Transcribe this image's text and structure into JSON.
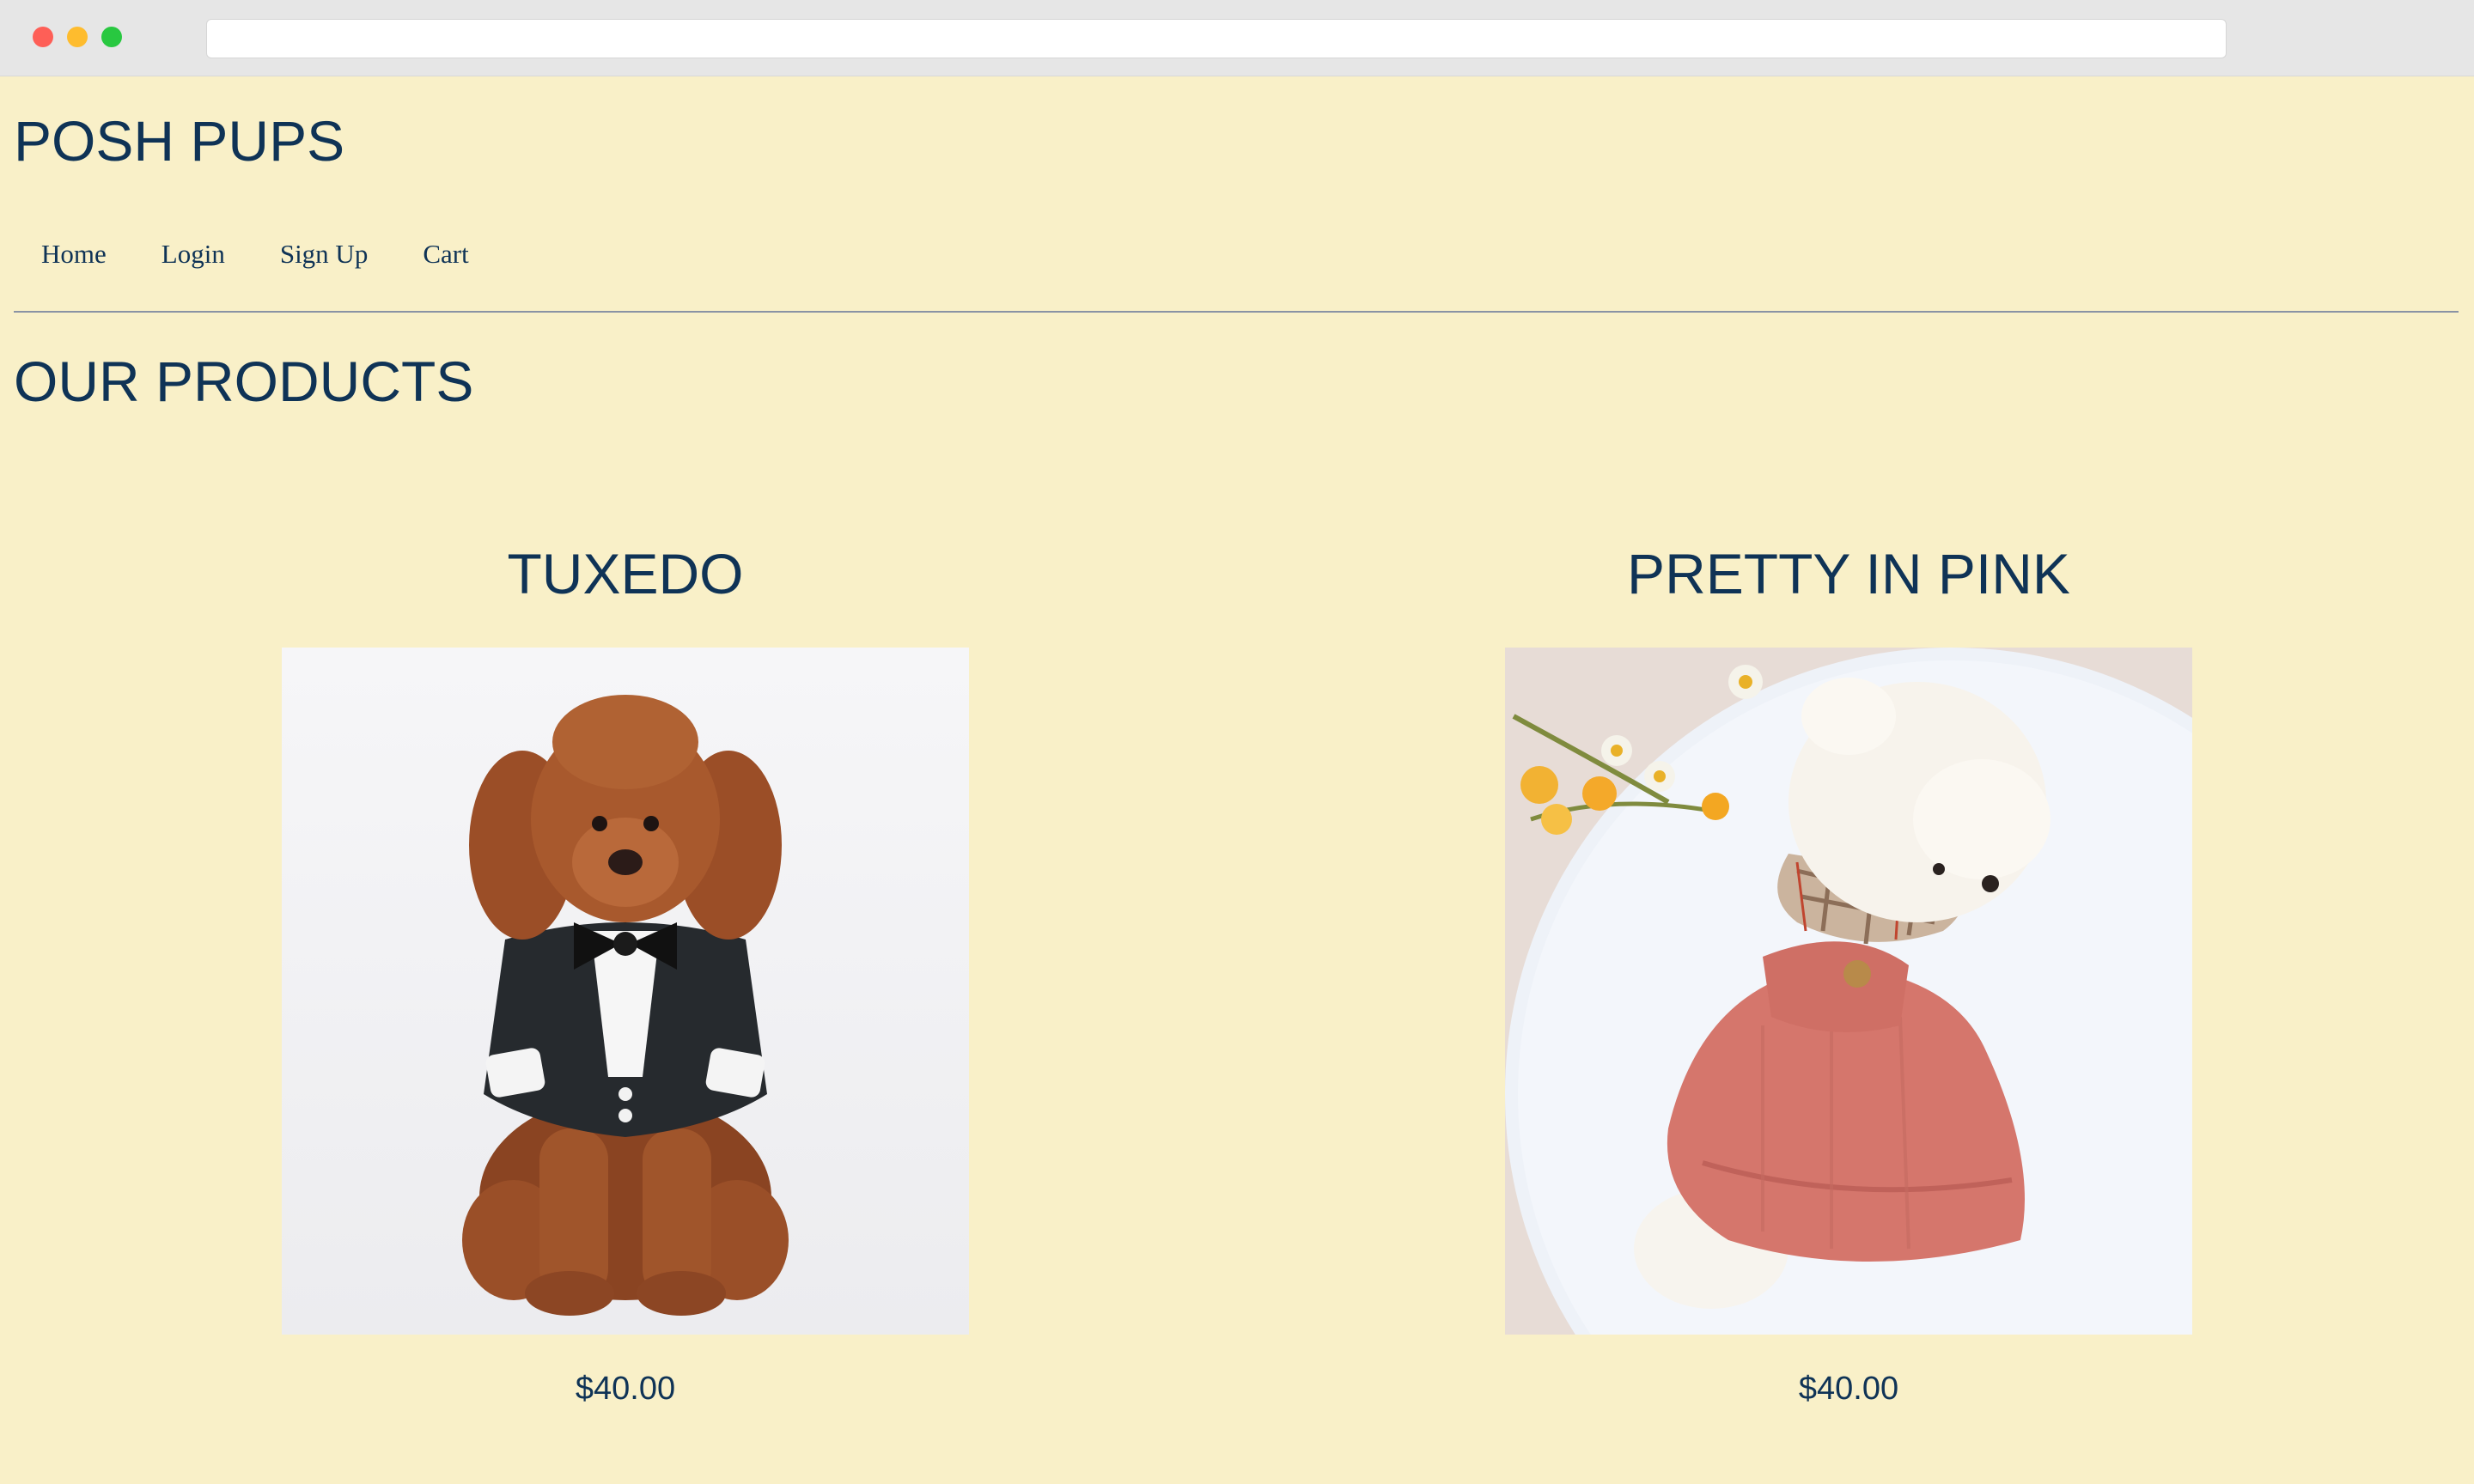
{
  "browser": {
    "address": ""
  },
  "site": {
    "title": "POSH PUPS"
  },
  "nav": {
    "items": [
      {
        "label": "Home"
      },
      {
        "label": "Login"
      },
      {
        "label": "Sign Up"
      },
      {
        "label": "Cart"
      }
    ]
  },
  "products_section": {
    "heading": "OUR PRODUCTS",
    "items": [
      {
        "name": "TUXEDO",
        "price": "$40.00",
        "image": "poodle-in-black-tuxedo-photo"
      },
      {
        "name": "PRETTY IN PINK",
        "price": "$40.00",
        "image": "white-pomeranian-in-pink-dress-photo"
      }
    ]
  },
  "colors": {
    "background": "#f9f0c8",
    "text": "#0f3356",
    "divider": "#8a93a4"
  }
}
